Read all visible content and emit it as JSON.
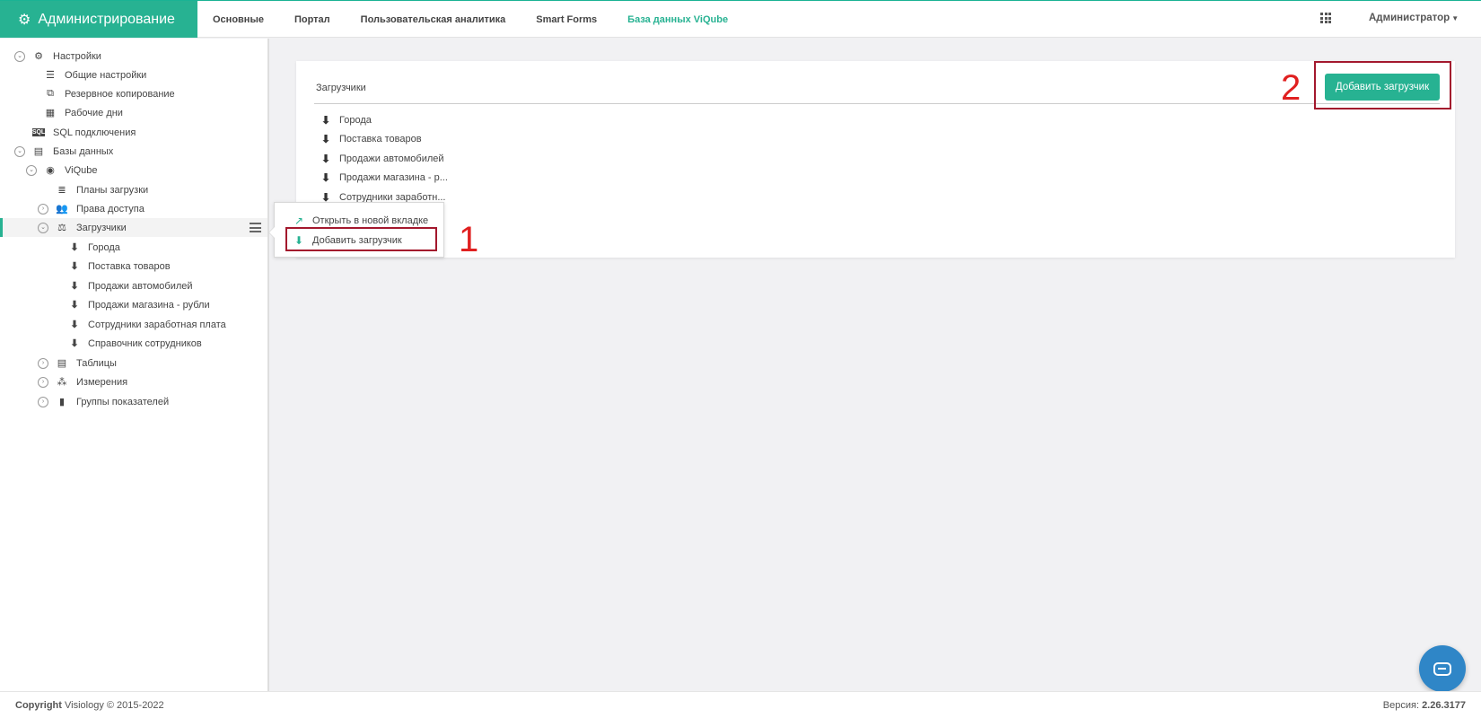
{
  "header": {
    "brand": "Администрирование",
    "nav": [
      "Основные",
      "Портал",
      "Пользовательская аналитика",
      "Smart Forms",
      "База данных ViQube"
    ],
    "active_nav": "База данных ViQube",
    "user": "Администратор"
  },
  "sidebar": {
    "settings": "Настройки",
    "general_settings": "Общие настройки",
    "backup": "Резервное копирование",
    "workdays": "Рабочие дни",
    "sql": "SQL подключения",
    "databases": "Базы данных",
    "viqube": "ViQube",
    "load_plans": "Планы загрузки",
    "access": "Права доступа",
    "loaders": "Загрузчики",
    "loader_items": [
      "Города",
      "Поставка товаров",
      "Продажи автомобилей",
      "Продажи магазина - рубли",
      "Сотрудники заработная плата",
      "Справочник сотрудников"
    ],
    "tables": "Таблицы",
    "dimensions": "Измерения",
    "indicator_groups": "Группы показателей"
  },
  "context_menu": {
    "open_new_tab": "Открыть в новой вкладке",
    "add_loader": "Добавить загрузчик"
  },
  "main": {
    "panel_title": "Загрузчики",
    "add_button": "Добавить загрузчик",
    "items": [
      "Города",
      "Поставка товаров",
      "Продажи автомобилей",
      "Продажи магазина - р...",
      "Сотрудники заработн..."
    ]
  },
  "annotations": {
    "one": "1",
    "two": "2"
  },
  "footer": {
    "copyright_bold": "Copyright",
    "copyright_rest": "Visiology © 2015-2022",
    "version_label": "Версия:",
    "version": "2.26.3177"
  },
  "colors": {
    "accent": "#27b292",
    "highlight_box": "#a3182d",
    "annotation": "#e02020",
    "chat": "#2f86c7"
  }
}
